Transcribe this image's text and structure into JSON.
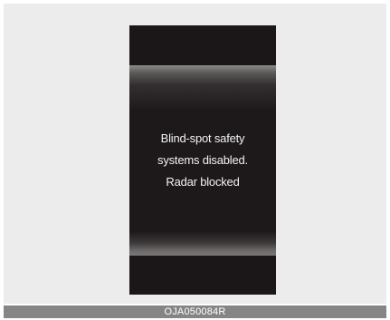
{
  "display": {
    "message_lines": [
      "Blind-spot safety",
      "systems disabled.",
      "Radar blocked"
    ]
  },
  "caption": {
    "code": "OJA050084R"
  }
}
